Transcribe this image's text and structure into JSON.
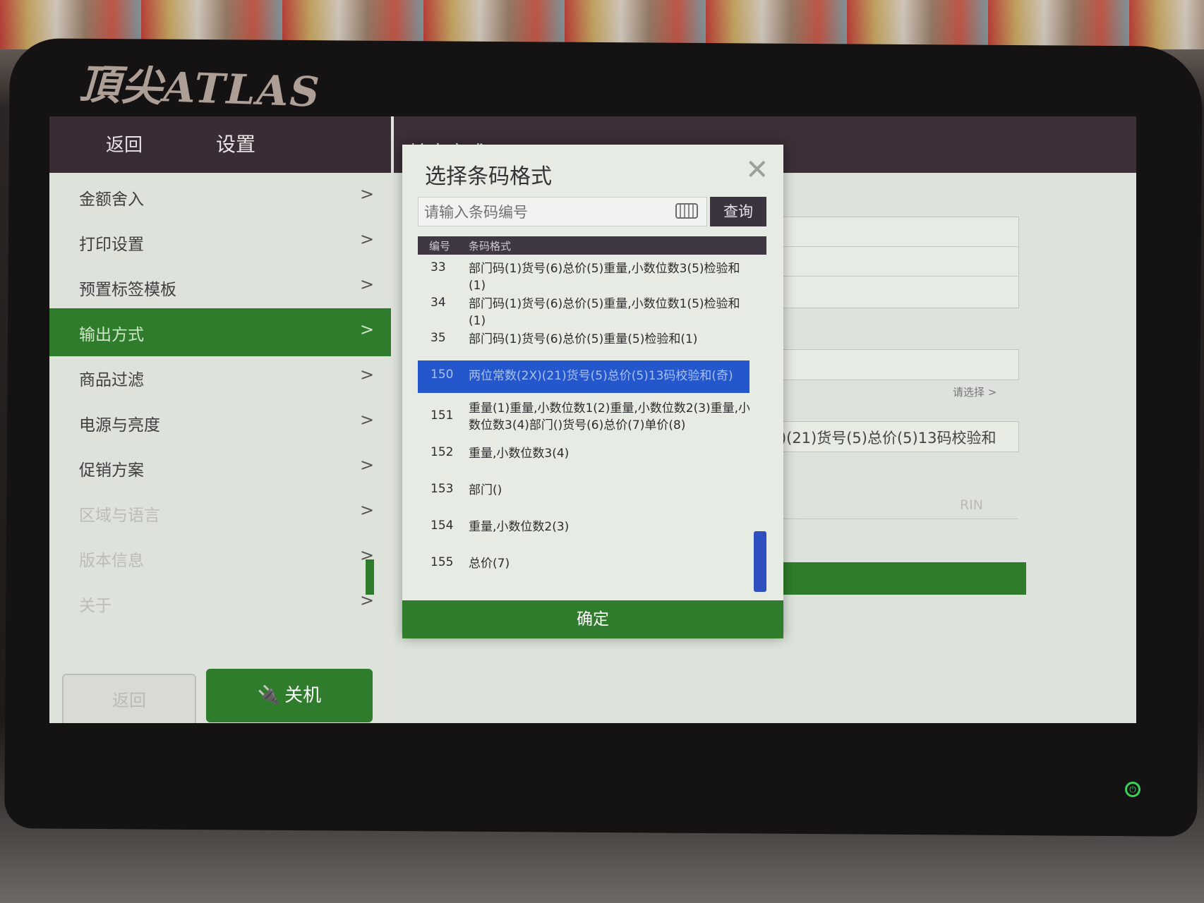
{
  "brand": "頂尖ATLAS",
  "header": {
    "back_label": "返回",
    "settings_title": "设置",
    "section_title": "输出方式"
  },
  "sidebar": {
    "items": [
      {
        "label": "金额舍入",
        "chevron": ">"
      },
      {
        "label": "打印设置",
        "chevron": ">"
      },
      {
        "label": "预置标签模板",
        "chevron": ">"
      },
      {
        "label": "输出方式",
        "chevron": ">"
      },
      {
        "label": "商品过滤",
        "chevron": ">"
      },
      {
        "label": "电源与亮度",
        "chevron": ">"
      },
      {
        "label": "促销方案",
        "chevron": ">"
      },
      {
        "label": "区域与语言",
        "chevron": ">"
      },
      {
        "label": "版本信息",
        "chevron": ">"
      },
      {
        "label": "关于",
        "chevron": ">"
      }
    ],
    "active_index": 3,
    "btn_left_label": "返回",
    "shutdown_label": "关机"
  },
  "right_pane": {
    "please_select": "请选择 >",
    "format_value": "(2X)(21)货号(5)总价(5)13码校验和",
    "rin_value": "RIN"
  },
  "modal": {
    "title": "选择条码格式",
    "close_symbol": "✕",
    "search_placeholder": "请输入条码编号",
    "search_value": "",
    "query_label": "查询",
    "header_num": "编号",
    "header_format": "条码格式",
    "rows": [
      {
        "num": "33",
        "format": "部门码(1)货号(6)总价(5)重量,小数位数3(5)检验和(1)"
      },
      {
        "num": "34",
        "format": "部门码(1)货号(6)总价(5)重量,小数位数1(5)检验和(1)"
      },
      {
        "num": "35",
        "format": "部门码(1)货号(6)总价(5)重量(5)检验和(1)"
      },
      {
        "num": "150",
        "format": "两位常数(2X)(21)货号(5)总价(5)13码校验和(奇)"
      },
      {
        "num": "151",
        "format": "重量(1)重量,小数位数1(2)重量,小数位数2(3)重量,小数位数3(4)部门()货号(6)总价(7)单价(8)"
      },
      {
        "num": "152",
        "format": "重量,小数位数3(4)"
      },
      {
        "num": "153",
        "format": "部门()"
      },
      {
        "num": "154",
        "format": "重量,小数位数2(3)"
      },
      {
        "num": "155",
        "format": "总价(7)"
      }
    ],
    "selected_index": 3,
    "confirm_label": "确定"
  },
  "colors": {
    "accent_green": "#2f7d2c",
    "selection_blue": "#2457cc",
    "header_dark": "#3a2c35"
  }
}
